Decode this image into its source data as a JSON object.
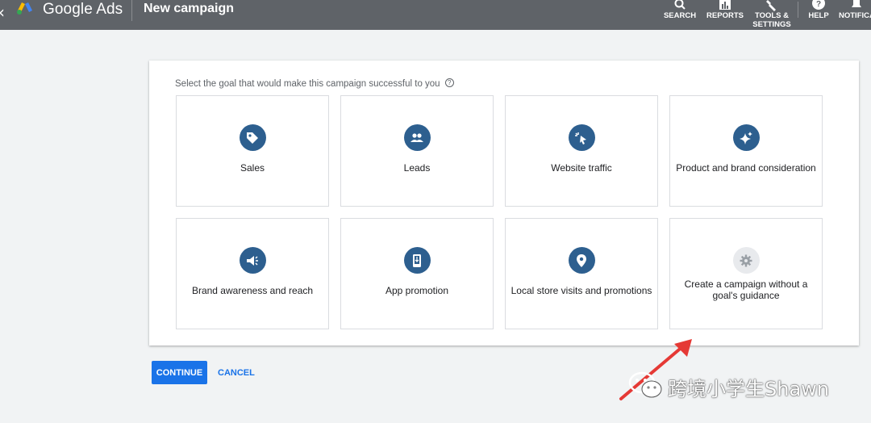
{
  "header": {
    "back_glyph": "‹",
    "brand": "Google Ads",
    "title": "New campaign",
    "tools": [
      {
        "label": "SEARCH"
      },
      {
        "label": "REPORTS"
      },
      {
        "label": "TOOLS & SETTINGS"
      },
      {
        "label": "HELP"
      },
      {
        "label": "NOTIFICATIONS"
      }
    ]
  },
  "goal_picker": {
    "prompt": "Select the goal that would make this campaign successful to you",
    "help_glyph": "?",
    "goals": [
      {
        "label": "Sales",
        "icon": "tag-icon"
      },
      {
        "label": "Leads",
        "icon": "people-icon"
      },
      {
        "label": "Website traffic",
        "icon": "cursor-click-icon"
      },
      {
        "label": "Product and brand consideration",
        "icon": "sparkle-icon"
      },
      {
        "label": "Brand awareness and reach",
        "icon": "megaphone-icon"
      },
      {
        "label": "App promotion",
        "icon": "phone-download-icon"
      },
      {
        "label": "Local store visits and promotions",
        "icon": "map-pin-icon"
      },
      {
        "label": "Create a campaign without a goal's guidance",
        "icon": "gear-icon"
      }
    ]
  },
  "actions": {
    "continue_label": "CONTINUE",
    "cancel_label": "CANCEL"
  },
  "watermark": {
    "text": "跨境小学生Shawn"
  },
  "colors": {
    "topbar": "#5f6368",
    "accent": "#1a73e8",
    "icon_circle": "#2d5f8f",
    "annotation_arrow": "#e53935"
  }
}
